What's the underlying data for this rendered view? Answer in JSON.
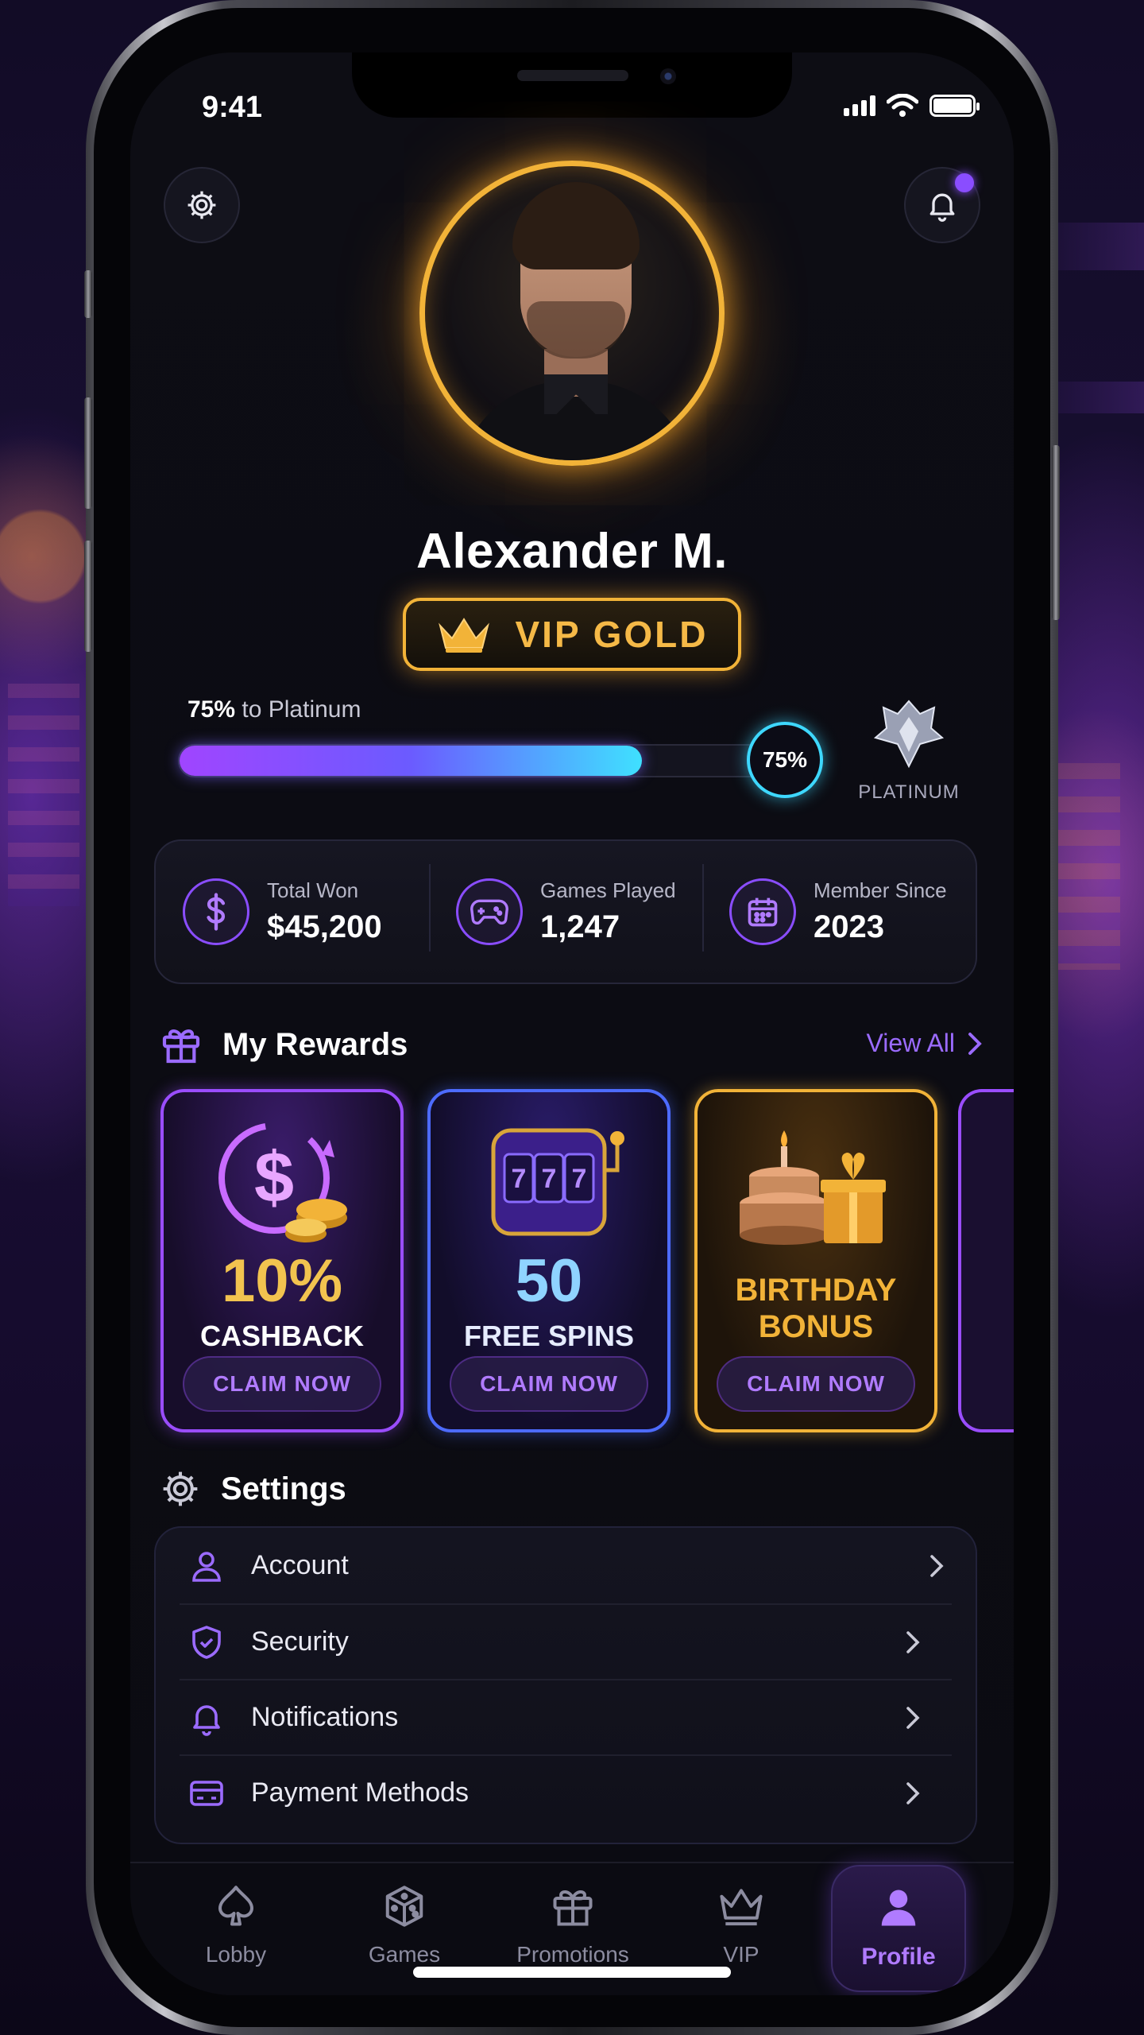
{
  "status_bar": {
    "time": "9:41"
  },
  "profile": {
    "name": "Alexander M.",
    "tier": "VIP GOLD"
  },
  "progress": {
    "label_percent": "75%",
    "label_text": "to Platinum",
    "value": 0.75,
    "knob_text": "75%",
    "next_tier": "PLATINUM"
  },
  "stats": [
    {
      "label": "Total Won",
      "value": "$45,200",
      "icon": "dollar-icon"
    },
    {
      "label": "Games Played",
      "value": "1,247",
      "icon": "gamepad-icon"
    },
    {
      "label": "Member Since",
      "value": "2023",
      "icon": "calendar-icon"
    }
  ],
  "rewards": {
    "title": "My Rewards",
    "view_all": "View All",
    "cards": [
      {
        "big": "10%",
        "sub": "CASHBACK",
        "cta": "CLAIM NOW",
        "color": "#f2b338"
      },
      {
        "big": "50",
        "sub": "FREE SPINS",
        "cta": "CLAIM NOW",
        "color": "#6ec4ff"
      },
      {
        "line1": "BIRTHDAY",
        "line2": "BONUS",
        "cta": "CLAIM NOW",
        "color": "#f2b338"
      }
    ]
  },
  "settings": {
    "title": "Settings",
    "items": [
      {
        "label": "Account",
        "icon": "user-icon"
      },
      {
        "label": "Security",
        "icon": "shield-icon"
      },
      {
        "label": "Notifications",
        "icon": "bell-icon"
      },
      {
        "label": "Payment Methods",
        "icon": "card-icon"
      }
    ]
  },
  "nav": {
    "items": [
      {
        "label": "Lobby",
        "icon": "spade-icon"
      },
      {
        "label": "Games",
        "icon": "dice-icon"
      },
      {
        "label": "Promotions",
        "icon": "gift-icon"
      },
      {
        "label": "VIP",
        "icon": "crown-icon"
      },
      {
        "label": "Profile",
        "icon": "profile-icon",
        "active": true
      }
    ]
  },
  "colors": {
    "accent_purple": "#8a4dff",
    "gold": "#f2b338",
    "cyan": "#3ed8ff"
  }
}
